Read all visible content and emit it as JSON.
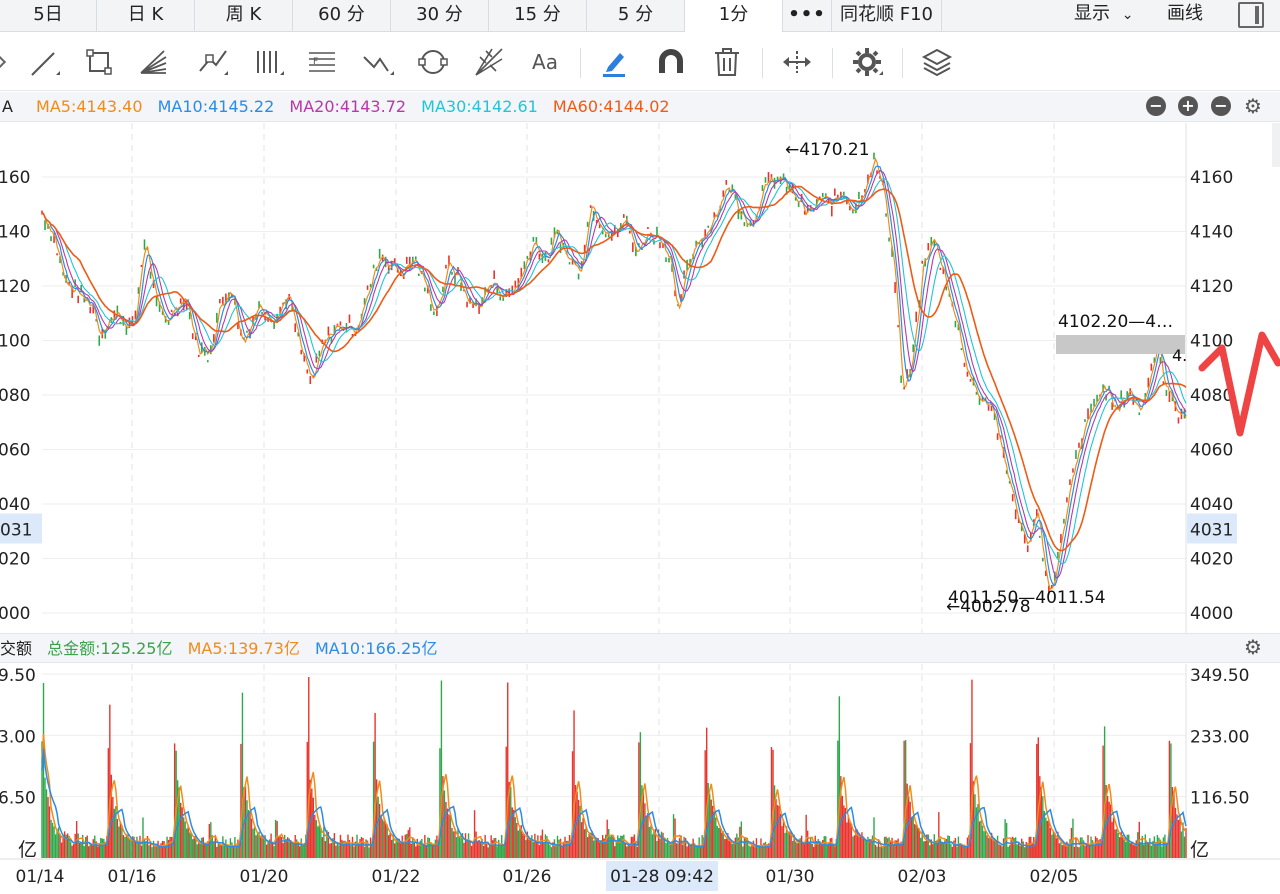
{
  "tabs": {
    "items": [
      {
        "label": "5日",
        "active": false
      },
      {
        "label": "日 K",
        "active": false
      },
      {
        "label": "周 K",
        "active": false
      },
      {
        "label": "60 分",
        "active": false
      },
      {
        "label": "30 分",
        "active": false
      },
      {
        "label": "15 分",
        "active": false
      },
      {
        "label": "5 分",
        "active": false
      },
      {
        "label": "1分",
        "active": true
      }
    ],
    "more": "•••",
    "f10": "同花顺 F10",
    "display": "显示",
    "draw": "画线"
  },
  "toolbar": {
    "icons": [
      "line-tool-icon",
      "rect-tool-icon",
      "fan-tool-icon",
      "pattern-tool-icon",
      "parallel-lines-icon",
      "fib-tool-icon",
      "wave-tool-icon",
      "cycle-tool-icon",
      "gann-tool-icon",
      "text-tool-icon",
      "pen-icon",
      "magnet-icon",
      "trash-icon",
      "move-icon",
      "settings-icon",
      "layers-icon"
    ],
    "text_tool": "Aa"
  },
  "ma_bar": {
    "prefix": "A",
    "ma5": "MA5:4143.40",
    "ma10": "MA10:4145.22",
    "ma20": "MA20:4143.72",
    "ma30": "MA30:4142.61",
    "ma60": "MA60:4144.02",
    "colors": {
      "ma5": "#f08c1a",
      "ma10": "#2b8ce6",
      "ma20": "#b938a8",
      "ma30": "#1fc6d6",
      "ma60": "#f05a14"
    }
  },
  "vol_bar": {
    "label": "交额",
    "total": "总金额:125.25亿",
    "ma5": "MA5:139.73亿",
    "ma10": "MA10:166.25亿"
  },
  "chart_data": [
    {
      "type": "line",
      "ylim": [
        4000,
        4170
      ],
      "y_ticks": [
        "4160",
        "4140",
        "4120",
        "4100",
        "4080",
        "4060",
        "4040",
        "4020",
        "4000"
      ],
      "left_ticks": [
        "160",
        "140",
        "120",
        "100",
        "080",
        "060",
        "040",
        "020",
        "000"
      ],
      "current_price": "4031",
      "left_current": "031",
      "x_labels": [
        "01/14",
        "01/16",
        "01/20",
        "01/22",
        "01/26",
        "01-28 09:42",
        "01/30",
        "02/03",
        "02/05"
      ],
      "annotations": {
        "high": "←4170.21",
        "low": "←4002.78",
        "range_low": "4011.50—4011.54",
        "range_high": "4102.20—4…",
        "range_edge": "4."
      },
      "price_path": [
        [
          0.0,
          4147
        ],
        [
          0.01,
          4138
        ],
        [
          0.02,
          4122
        ],
        [
          0.03,
          4118
        ],
        [
          0.045,
          4112
        ],
        [
          0.05,
          4102
        ],
        [
          0.065,
          4110
        ],
        [
          0.08,
          4104
        ],
        [
          0.09,
          4138
        ],
        [
          0.1,
          4112
        ],
        [
          0.11,
          4108
        ],
        [
          0.125,
          4116
        ],
        [
          0.135,
          4098
        ],
        [
          0.145,
          4094
        ],
        [
          0.155,
          4112
        ],
        [
          0.165,
          4120
        ],
        [
          0.175,
          4100
        ],
        [
          0.19,
          4112
        ],
        [
          0.205,
          4108
        ],
        [
          0.215,
          4117
        ],
        [
          0.225,
          4098
        ],
        [
          0.235,
          4084
        ],
        [
          0.245,
          4098
        ],
        [
          0.255,
          4104
        ],
        [
          0.265,
          4106
        ],
        [
          0.275,
          4104
        ],
        [
          0.285,
          4118
        ],
        [
          0.295,
          4132
        ],
        [
          0.305,
          4128
        ],
        [
          0.315,
          4125
        ],
        [
          0.325,
          4131
        ],
        [
          0.335,
          4119
        ],
        [
          0.345,
          4110
        ],
        [
          0.355,
          4128
        ],
        [
          0.365,
          4122
        ],
        [
          0.375,
          4112
        ],
        [
          0.385,
          4115
        ],
        [
          0.395,
          4122
        ],
        [
          0.405,
          4115
        ],
        [
          0.42,
          4125
        ],
        [
          0.43,
          4138
        ],
        [
          0.44,
          4128
        ],
        [
          0.45,
          4140
        ],
        [
          0.46,
          4130
        ],
        [
          0.47,
          4126
        ],
        [
          0.48,
          4150
        ],
        [
          0.49,
          4142
        ],
        [
          0.5,
          4138
        ],
        [
          0.51,
          4145
        ],
        [
          0.52,
          4132
        ],
        [
          0.53,
          4140
        ],
        [
          0.54,
          4138
        ],
        [
          0.55,
          4128
        ],
        [
          0.555,
          4108
        ],
        [
          0.56,
          4120
        ],
        [
          0.57,
          4134
        ],
        [
          0.58,
          4140
        ],
        [
          0.59,
          4147
        ],
        [
          0.6,
          4158
        ],
        [
          0.61,
          4148
        ],
        [
          0.62,
          4142
        ],
        [
          0.63,
          4155
        ],
        [
          0.64,
          4160
        ],
        [
          0.65,
          4157
        ],
        [
          0.66,
          4152
        ],
        [
          0.67,
          4146
        ],
        [
          0.68,
          4152
        ],
        [
          0.69,
          4150
        ],
        [
          0.7,
          4155
        ],
        [
          0.71,
          4148
        ],
        [
          0.72,
          4158
        ],
        [
          0.727,
          4166
        ],
        [
          0.735,
          4156
        ],
        [
          0.745,
          4126
        ],
        [
          0.752,
          4080
        ],
        [
          0.76,
          4090
        ],
        [
          0.77,
          4128
        ],
        [
          0.78,
          4138
        ],
        [
          0.79,
          4120
        ],
        [
          0.8,
          4106
        ],
        [
          0.81,
          4086
        ],
        [
          0.82,
          4080
        ],
        [
          0.83,
          4076
        ],
        [
          0.84,
          4058
        ],
        [
          0.85,
          4040
        ],
        [
          0.86,
          4024
        ],
        [
          0.87,
          4036
        ],
        [
          0.875,
          4022
        ],
        [
          0.88,
          4006
        ],
        [
          0.89,
          4024
        ],
        [
          0.9,
          4050
        ],
        [
          0.91,
          4066
        ],
        [
          0.92,
          4078
        ],
        [
          0.93,
          4082
        ],
        [
          0.94,
          4075
        ],
        [
          0.95,
          4082
        ],
        [
          0.96,
          4074
        ],
        [
          0.97,
          4090
        ],
        [
          0.975,
          4102
        ],
        [
          0.98,
          4085
        ],
        [
          0.99,
          4075
        ],
        [
          1.0,
          4070
        ]
      ]
    },
    {
      "type": "bar",
      "ylim": [
        0,
        349.5
      ],
      "y_ticks": [
        "349.50",
        "233.00",
        "116.50"
      ],
      "left_ticks": [
        "9.50",
        "3.00",
        "6.50"
      ],
      "unit": "亿"
    }
  ]
}
